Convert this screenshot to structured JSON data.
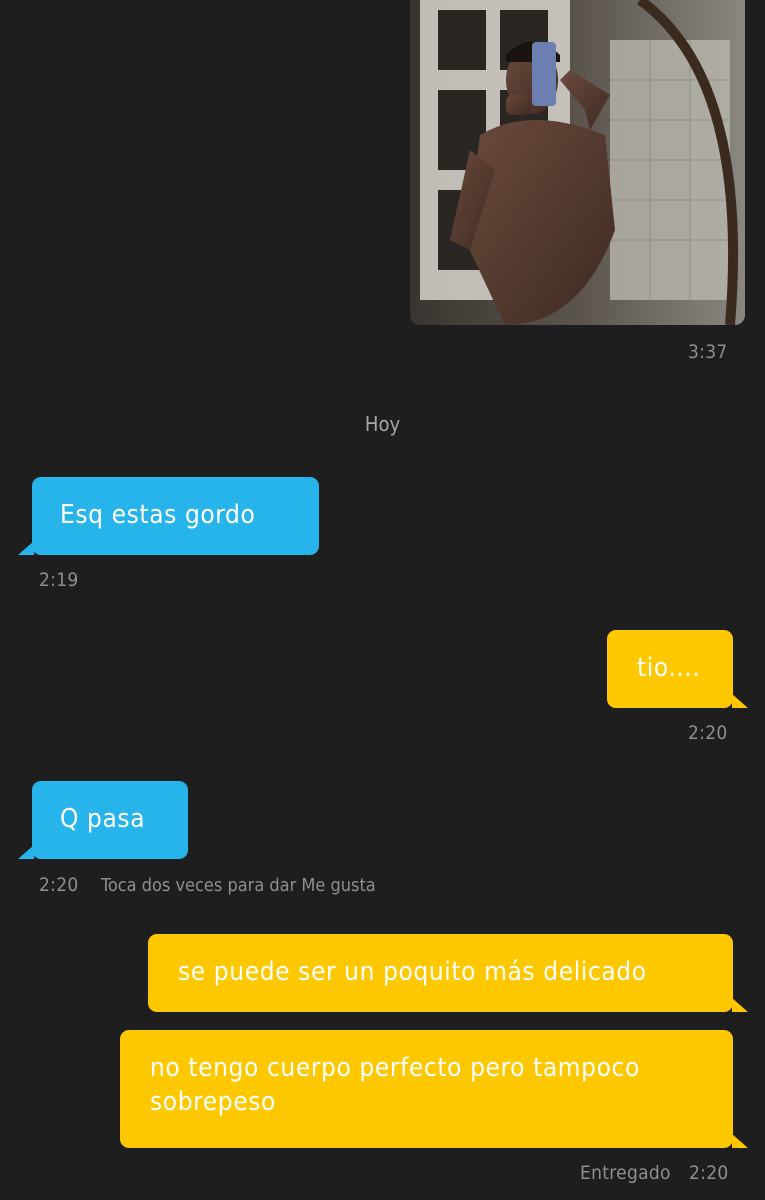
{
  "photo_message": {
    "image_icon": "mirror-selfie-photo",
    "time": "3:37"
  },
  "date_separator": "Hoy",
  "messages": [
    {
      "direction": "in",
      "text": "Esq estas gordo",
      "time": "2:19"
    },
    {
      "direction": "out",
      "text": "tio....",
      "time": "2:20"
    },
    {
      "direction": "in",
      "text": "Q pasa",
      "time": "2:20",
      "hint": "Toca dos veces para dar Me gusta"
    },
    {
      "direction": "out",
      "text": "se puede ser un poquito más delicado"
    },
    {
      "direction": "out",
      "text": "no tengo cuerpo perfecto pero tampoco sobrepeso",
      "status": "Entregado",
      "time": "2:20"
    }
  ],
  "colors": {
    "background": "#1e1e1f",
    "incoming_bubble": "#27b4ea",
    "outgoing_bubble": "#fdc800",
    "meta_text": "#8e8e93"
  }
}
